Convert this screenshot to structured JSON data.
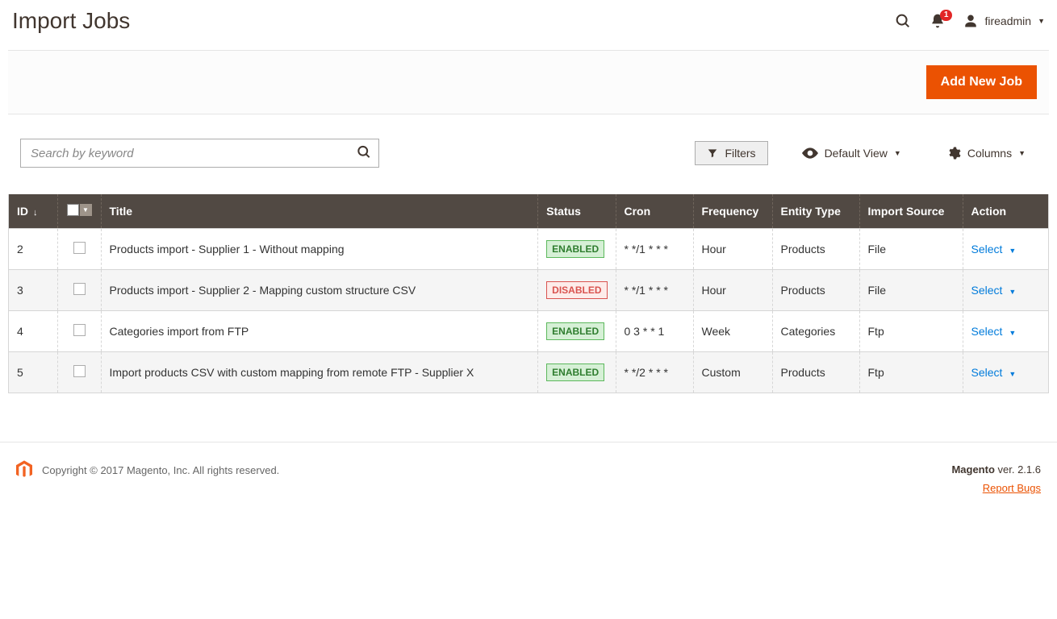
{
  "header": {
    "title": "Import Jobs",
    "notif_count": "1",
    "username": "fireadmin"
  },
  "actions": {
    "add_new": "Add New Job"
  },
  "toolbar": {
    "search_placeholder": "Search by keyword",
    "filters": "Filters",
    "default_view": "Default View",
    "columns": "Columns"
  },
  "table": {
    "columns": {
      "id": "ID",
      "title": "Title",
      "status": "Status",
      "cron": "Cron",
      "frequency": "Frequency",
      "entity_type": "Entity Type",
      "import_source": "Import Source",
      "action": "Action"
    },
    "action_label": "Select",
    "status_labels": {
      "enabled": "ENABLED",
      "disabled": "DISABLED"
    },
    "rows": [
      {
        "id": "2",
        "title": "Products import - Supplier 1 - Without mapping",
        "status": "enabled",
        "cron": "* */1 * * *",
        "frequency": "Hour",
        "entity_type": "Products",
        "import_source": "File"
      },
      {
        "id": "3",
        "title": "Products import - Supplier 2 - Mapping custom structure CSV",
        "status": "disabled",
        "cron": "* */1 * * *",
        "frequency": "Hour",
        "entity_type": "Products",
        "import_source": "File"
      },
      {
        "id": "4",
        "title": "Categories import from FTP",
        "status": "enabled",
        "cron": "0 3 * * 1",
        "frequency": "Week",
        "entity_type": "Categories",
        "import_source": "Ftp"
      },
      {
        "id": "5",
        "title": "Import products CSV with custom mapping from remote FTP - Supplier X",
        "status": "enabled",
        "cron": "* */2 * * *",
        "frequency": "Custom",
        "entity_type": "Products",
        "import_source": "Ftp"
      }
    ]
  },
  "footer": {
    "copyright": "Copyright © 2017 Magento, Inc. All rights reserved.",
    "brand": "Magento",
    "version_prefix": " ver. ",
    "version": "2.1.6",
    "report_bugs": "Report Bugs"
  }
}
